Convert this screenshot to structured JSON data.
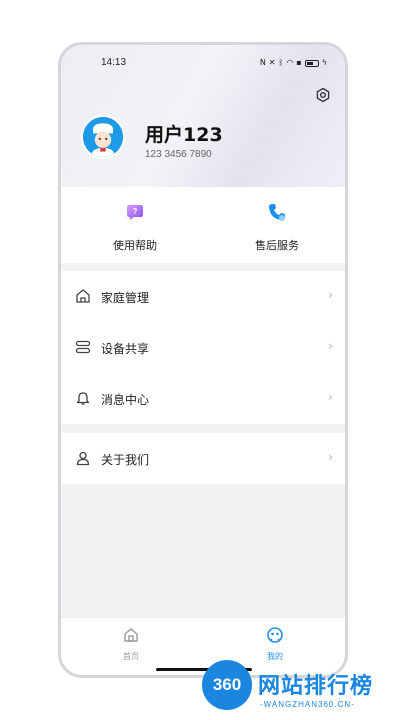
{
  "status_bar": {
    "time": "14:13",
    "icons": [
      "nfc-icon",
      "mute-icon",
      "bluetooth-icon",
      "wifi-icon",
      "sim-icon",
      "battery-icon",
      "charging-icon"
    ]
  },
  "profile": {
    "username": "用户123",
    "phone": "123 3456 7890"
  },
  "quick_actions": [
    {
      "label": "使用帮助",
      "icon": "help-icon",
      "color": "#9b5cf0"
    },
    {
      "label": "售后服务",
      "icon": "phone-service-icon",
      "color": "#1e8ff0"
    }
  ],
  "menu_group_1": [
    {
      "label": "家庭管理",
      "icon": "home-icon"
    },
    {
      "label": "设备共享",
      "icon": "device-share-icon"
    },
    {
      "label": "消息中心",
      "icon": "bell-icon"
    }
  ],
  "menu_group_2": [
    {
      "label": "关于我们",
      "icon": "person-icon"
    }
  ],
  "tabbar": {
    "home_label": "首页",
    "mine_label": "我的",
    "active_color": "#1e8ff0",
    "inactive_color": "#999999"
  },
  "watermark": {
    "badge": "360",
    "title": "网站排行榜",
    "subtitle": "-WANGZHAN360.CN-"
  },
  "colors": {
    "accent": "#1e8ff0",
    "help_purple": "#9b5cf0"
  }
}
